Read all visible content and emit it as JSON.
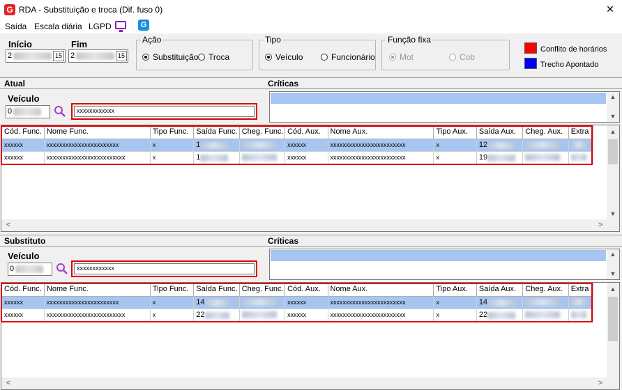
{
  "window": {
    "title": "RDA - Substituição e troca (Dif. fuso 0)",
    "close": "✕",
    "logo": "G"
  },
  "menu": {
    "items": [
      "Saída",
      "Escala diária",
      "LGPD"
    ],
    "icon_monitor": "monitor-icon",
    "icon_app": "G"
  },
  "dates": {
    "inicio_label": "Início",
    "fim_label": "Fim",
    "inicio_prefix": "2",
    "fim_prefix": "2",
    "cal_icon": "15"
  },
  "acao": {
    "label": "Ação",
    "options": [
      "Substituição",
      "Troca"
    ],
    "selected": "Substituição"
  },
  "tipo": {
    "label": "Tipo",
    "options": [
      "Veículo",
      "Funcionário"
    ],
    "selected": "Veículo"
  },
  "funcao_fixa": {
    "label": "Função fixa",
    "options": [
      "Mot",
      "Cob"
    ],
    "selected": "Mot"
  },
  "legend": [
    {
      "label": "Conflito de horários",
      "color": "#ff0000"
    },
    {
      "label": "Trecho Apontado",
      "color": "#0000ff"
    }
  ],
  "atual": {
    "section": "Atual",
    "criticas": "Críticas",
    "veiculo_label": "Veículo",
    "veiculo_prefix": "0",
    "descricao": "xxxxxxxxxxxx",
    "columns": [
      "Cód. Func.",
      "Nome Func.",
      "Tipo Func.",
      "Saída Func.",
      "Cheg. Func.",
      "Cód. Aux.",
      "Nome Aux.",
      "Tipo Aux.",
      "Saída Aux.",
      "Cheg. Aux.",
      "Extra"
    ],
    "rows": [
      {
        "cod": "xxxxxx",
        "nome": "xxxxxxxxxxxxxxxxxxxxxxx",
        "tipo": "x",
        "saida": "1",
        "cod_aux": "xxxxxx",
        "nome_aux": "xxxxxxxxxxxxxxxxxxxxxxxx",
        "tipo_aux": "x",
        "saida_aux": "12"
      },
      {
        "cod": "xxxxxx",
        "nome": "xxxxxxxxxxxxxxxxxxxxxxxxx",
        "tipo": "x",
        "saida": "1",
        "cod_aux": "xxxxxx",
        "nome_aux": "xxxxxxxxxxxxxxxxxxxxxxxx",
        "tipo_aux": "x",
        "saida_aux": "19"
      }
    ]
  },
  "substituto": {
    "section": "Substituto",
    "criticas": "Críticas",
    "veiculo_label": "Veículo",
    "veiculo_prefix": "0",
    "descricao": "xxxxxxxxxxxx",
    "columns": [
      "Cód. Func.",
      "Nome Func.",
      "Tipo Func.",
      "Saída Func.",
      "Cheg. Func.",
      "Cód. Aux.",
      "Nome Aux.",
      "Tipo Aux.",
      "Saída Aux.",
      "Cheg. Aux.",
      "Extra"
    ],
    "rows": [
      {
        "cod": "xxxxxx",
        "nome": "xxxxxxxxxxxxxxxxxxxxxxx",
        "tipo": "x",
        "saida": "14",
        "cod_aux": "xxxxxx",
        "nome_aux": "xxxxxxxxxxxxxxxxxxxxxxxx",
        "tipo_aux": "x",
        "saida_aux": "14"
      },
      {
        "cod": "xxxxxx",
        "nome": "xxxxxxxxxxxxxxxxxxxxxxxxx",
        "tipo": "x",
        "saida": "22",
        "cod_aux": "xxxxxx",
        "nome_aux": "xxxxxxxxxxxxxxxxxxxxxxxx",
        "tipo_aux": "x",
        "saida_aux": "22"
      }
    ]
  },
  "colors": {
    "selection": "#a6c5f0",
    "highlight_border": "#e00000"
  }
}
